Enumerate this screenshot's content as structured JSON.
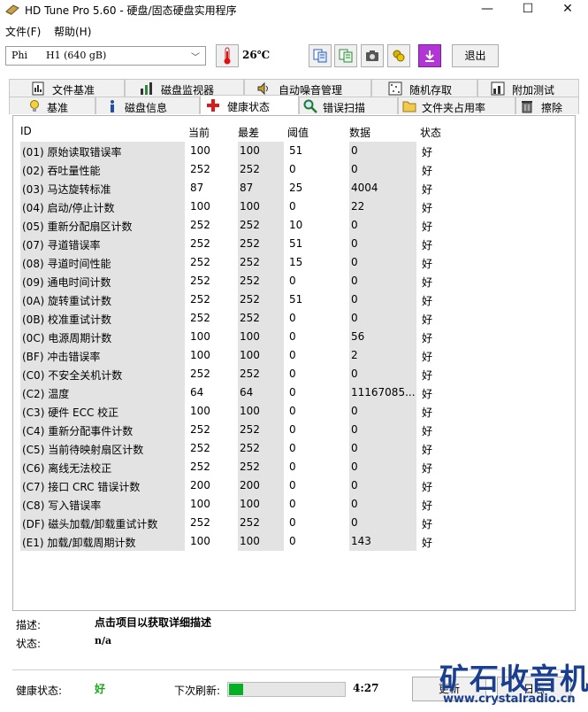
{
  "window": {
    "title": "HD Tune Pro 5.60 - 硬盘/固态硬盘实用程序",
    "min": "—",
    "max": "☐",
    "close": "✕"
  },
  "menu": [
    {
      "label": "文件(F)"
    },
    {
      "label": "帮助(H)"
    }
  ],
  "toolbar": {
    "drive": "Phi      H1 (640 gB)",
    "temperature": "26℃",
    "exit_label": "退出",
    "buttons": [
      "copy-text-icon",
      "copy-info-icon",
      "screenshot-icon",
      "options-icon",
      "save-icon"
    ]
  },
  "tabs_top": [
    {
      "label": "文件基准",
      "icon": "file-benchmark-icon"
    },
    {
      "label": "磁盘监视器",
      "icon": "disk-monitor-icon"
    },
    {
      "label": "自动噪音管理",
      "icon": "speaker-icon"
    },
    {
      "label": "随机存取",
      "icon": "random-access-icon"
    },
    {
      "label": "附加测试",
      "icon": "extra-tests-icon"
    }
  ],
  "tabs_bottom": [
    {
      "label": "基准",
      "icon": "benchmark-icon"
    },
    {
      "label": "磁盘信息",
      "icon": "info-icon"
    },
    {
      "label": "健康状态",
      "icon": "health-cross-icon",
      "active": true
    },
    {
      "label": "错误扫描",
      "icon": "magnifier-icon"
    },
    {
      "label": "文件夹占用率",
      "icon": "folder-icon"
    },
    {
      "label": "擦除",
      "icon": "trash-icon"
    }
  ],
  "smart": {
    "headers": [
      "ID",
      "当前",
      "最差",
      "阈值",
      "数据",
      "状态"
    ],
    "rows": [
      [
        "(01) 原始读取错误率",
        "100",
        "100",
        "51",
        "0",
        "好"
      ],
      [
        "(02) 吞吐量性能",
        "252",
        "252",
        "0",
        "0",
        "好"
      ],
      [
        "(03) 马达旋转标准",
        "87",
        "87",
        "25",
        "4004",
        "好"
      ],
      [
        "(04) 启动/停止计数",
        "100",
        "100",
        "0",
        "22",
        "好"
      ],
      [
        "(05) 重新分配扇区计数",
        "252",
        "252",
        "10",
        "0",
        "好"
      ],
      [
        "(07) 寻道错误率",
        "252",
        "252",
        "51",
        "0",
        "好"
      ],
      [
        "(08) 寻道时间性能",
        "252",
        "252",
        "15",
        "0",
        "好"
      ],
      [
        "(09) 通电时间计数",
        "252",
        "252",
        "0",
        "0",
        "好"
      ],
      [
        "(0A) 旋转重试计数",
        "252",
        "252",
        "51",
        "0",
        "好"
      ],
      [
        "(0B) 校准重试计数",
        "252",
        "252",
        "0",
        "0",
        "好"
      ],
      [
        "(0C) 电源周期计数",
        "100",
        "100",
        "0",
        "56",
        "好"
      ],
      [
        "(BF) 冲击错误率",
        "100",
        "100",
        "0",
        "2",
        "好"
      ],
      [
        "(C0) 不安全关机计数",
        "252",
        "252",
        "0",
        "0",
        "好"
      ],
      [
        "(C2) 温度",
        "64",
        "64",
        "0",
        "11167085...",
        "好"
      ],
      [
        "(C3) 硬件 ECC 校正",
        "100",
        "100",
        "0",
        "0",
        "好"
      ],
      [
        "(C4) 重新分配事件计数",
        "252",
        "252",
        "0",
        "0",
        "好"
      ],
      [
        "(C5) 当前待映射扇区计数",
        "252",
        "252",
        "0",
        "0",
        "好"
      ],
      [
        "(C6) 离线无法校正",
        "252",
        "252",
        "0",
        "0",
        "好"
      ],
      [
        "(C7) 接口 CRC 错误计数",
        "200",
        "200",
        "0",
        "0",
        "好"
      ],
      [
        "(C8) 写入错误率",
        "100",
        "100",
        "0",
        "0",
        "好"
      ],
      [
        "(DF) 磁头加载/卸载重试计数",
        "252",
        "252",
        "0",
        "0",
        "好"
      ],
      [
        "(E1) 加载/卸载周期计数",
        "100",
        "100",
        "0",
        "143",
        "好"
      ]
    ]
  },
  "details": {
    "desc_label": "描述:",
    "desc_value": "点击项目以获取详细描述",
    "status_label": "状态:",
    "status_value": "n/a"
  },
  "footer": {
    "health_label": "健康状态:",
    "health_value": "好",
    "refresh_label": "下次刷新:",
    "refresh_progress": 0.12,
    "timer": "4:27",
    "update_label": "更新",
    "log_label": "日志"
  },
  "watermark": {
    "title": "矿石收音机",
    "url": "www.crystalradio.cn"
  },
  "colors": {
    "health_good": "#1aa51a",
    "progress": "#06b025",
    "watermark": "#1a3f8f",
    "cell_gray": "#e3e3e3"
  }
}
